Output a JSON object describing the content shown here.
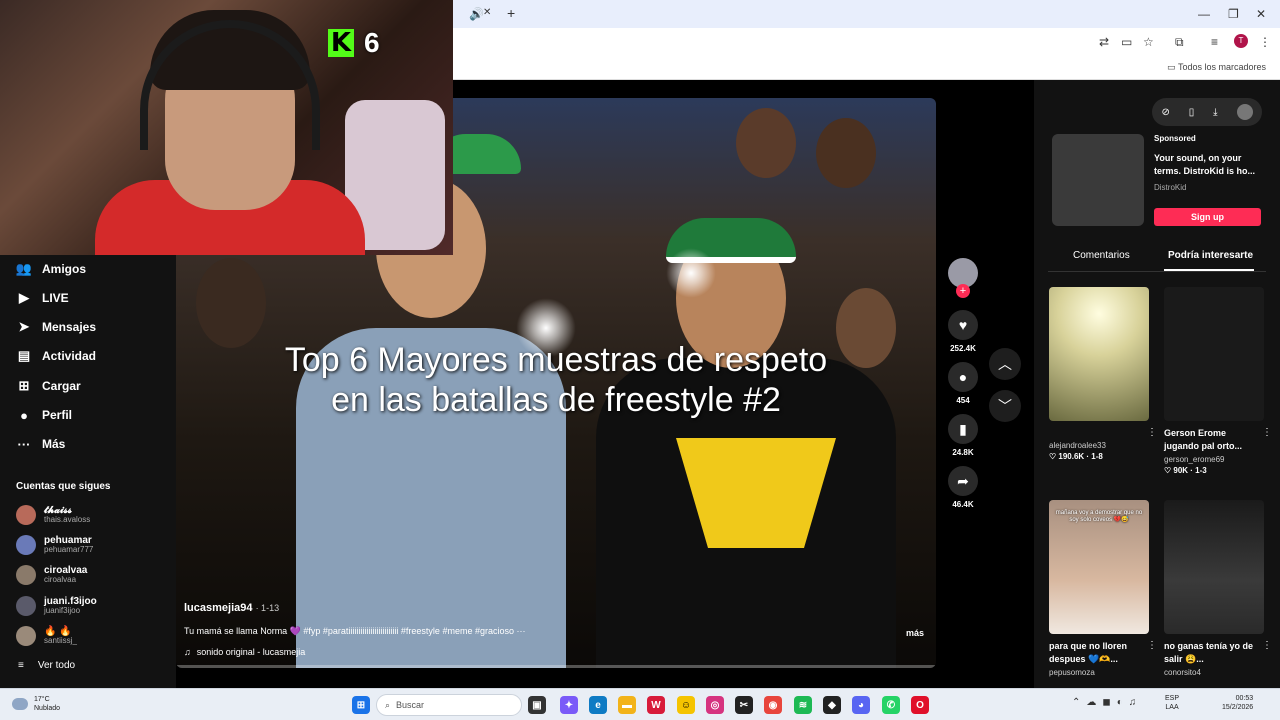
{
  "browser": {
    "tab_close": "✕",
    "new_tab": "+",
    "bookmarks_label": "Todos los marcadores",
    "user_initial": "T"
  },
  "stream_overlay": {
    "badge_letter": "K",
    "badge_number": "6"
  },
  "sidebar": {
    "items": [
      {
        "label": "Amigos",
        "icon": "people-icon",
        "glyph": "👥"
      },
      {
        "label": "LIVE",
        "icon": "live-icon",
        "glyph": "▶"
      },
      {
        "label": "Mensajes",
        "icon": "send-icon",
        "glyph": "➤"
      },
      {
        "label": "Actividad",
        "icon": "activity-icon",
        "glyph": "▤"
      },
      {
        "label": "Cargar",
        "icon": "upload-icon",
        "glyph": "⊞"
      },
      {
        "label": "Perfil",
        "icon": "profile-icon",
        "glyph": "●"
      },
      {
        "label": "Más",
        "icon": "more-icon",
        "glyph": "···"
      }
    ],
    "following_title": "Cuentas que sigues",
    "following": [
      {
        "name": "𝓽𝓱𝓪𝓲𝓼𝓼",
        "handle": "thais.avaloss",
        "color": "#b86a5a"
      },
      {
        "name": "pehuamar",
        "handle": "pehuamar777",
        "color": "#6a7ab8"
      },
      {
        "name": "ciroalvaa",
        "handle": "ciroalvaa",
        "color": "#8a7a6a"
      },
      {
        "name": "juani.f3ijoo",
        "handle": "juanif3ijoo",
        "color": "#5a5a6a"
      },
      {
        "name": "🔥 🔥",
        "handle": "santiissj_",
        "color": "#9a8a7a"
      }
    ],
    "see_all": "Ver todo"
  },
  "video": {
    "overlay_line1": "Top 6 Mayores muestras de respeto",
    "overlay_line2": "en las batallas de freestyle #2",
    "author": "lucasmejia94",
    "date": "· 1-13",
    "caption": "Tu mamá se llama Norma 💜 #fyp #paratiiiiiiiiiiiiiiiiiiiiiiiii #freestyle #meme #gracioso ···",
    "more": "más",
    "music": "sonido original - lucasmejia"
  },
  "actions": {
    "likes": "252.4K",
    "comments": "454",
    "saves": "24.8K",
    "shares": "46.4K"
  },
  "right_panel": {
    "sponsored": "Sponsored",
    "ad_text": "Your sound, on your terms. DistroKid is ho...",
    "ad_brand": "DistroKid",
    "signup": "Sign up",
    "tab_comments": "Comentarios",
    "tab_interest": "Podría interesarte",
    "cards": [
      {
        "author": "alejandroalee33",
        "stats": "♡ 190.6K · 1-8",
        "title": "",
        "thumb_text": "",
        "bg": "#c8c27a"
      },
      {
        "author": "gerson_erome69",
        "stats": "♡ 90K · 1-3",
        "title": "Gerson Erome jugando pal orto...",
        "thumb_text": "",
        "bg": "#1a1a1a"
      },
      {
        "author": "pepusomoza",
        "stats": "",
        "title": "para que no lloren despues 💙🫶...",
        "thumb_text": "mañana voy a demostrar que no soy solo coveos 💔😅",
        "bg": "#8a7060"
      },
      {
        "author": "conorsito4",
        "stats": "",
        "title": "no ganas tenía yo de salir 😩...",
        "thumb_text": "",
        "bg": "#2a2a2a"
      }
    ]
  },
  "taskbar": {
    "weather_temp": "17°C",
    "weather_desc": "Nublado",
    "search_placeholder": "Buscar",
    "lang_line1": "ESP",
    "lang_line2": "LAA",
    "time": "00:53",
    "date": "15/2/2026"
  }
}
